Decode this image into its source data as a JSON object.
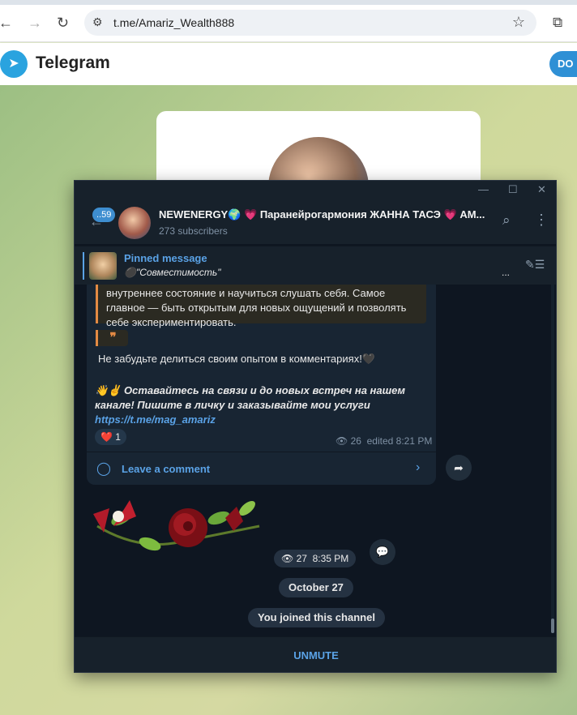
{
  "browser": {
    "url": "t.me/Amariz_Wealth888",
    "back_icon": "←",
    "forward_icon": "→",
    "reload_icon": "↻"
  },
  "telegram_web": {
    "title": "Telegram",
    "download_button": "DO"
  },
  "window": {
    "minimize_icon": "—",
    "maximize_icon": "☐",
    "close_icon": "✕"
  },
  "chat": {
    "unread_badge": "..59",
    "title": "NEWENERGY🌍 💗 Паранейрогармония ЖАННА ТАСЭ 💗 AM...",
    "subscribers": "273 subscribers",
    "pinned": {
      "label": "Pinned message",
      "text": "\"Совместимость\"",
      "ellipsis": "..."
    }
  },
  "message": {
    "quote_text": "внутреннее состояние и научиться слушать себя. Самое главное — быть открытым для новых ощущений и позволять себе экспериментировать.",
    "quote_mark": "❞",
    "line1": "Не забудьте делиться своим опытом в комментариях!🖤",
    "line2_prefix": "👋✌️ Оставайтесь на связи и до новых встреч на нашем канале!                       Пишите в личку и заказывайте мои услуги  ",
    "link": "https://t.me/mag_amariz",
    "reaction": "❤️ 1",
    "views": "26",
    "edited_time": "edited 8:21 PM",
    "comment_label": "Leave a comment"
  },
  "sticker_message": {
    "views": "27",
    "time": "8:35 PM"
  },
  "service": {
    "date": "October 27",
    "joined": "You joined this channel"
  },
  "footer": {
    "unmute": "UNMUTE"
  }
}
